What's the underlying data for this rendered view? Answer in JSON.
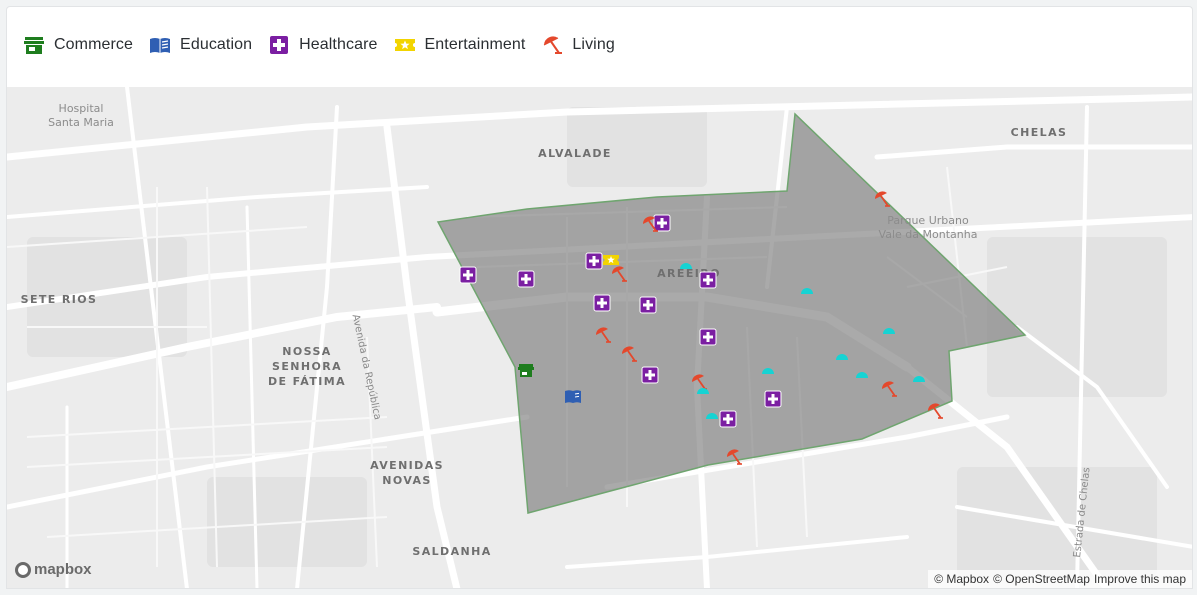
{
  "legend": [
    {
      "key": "commerce",
      "label": "Commerce",
      "icon": "store-icon",
      "color": "#1e7d1e"
    },
    {
      "key": "education",
      "label": "Education",
      "icon": "book-icon",
      "color": "#2f5fb3"
    },
    {
      "key": "healthcare",
      "label": "Healthcare",
      "icon": "plus-square-icon",
      "color": "#7b1fa2"
    },
    {
      "key": "entertainment",
      "label": "Entertainment",
      "icon": "star-ticket-icon",
      "color": "#f2d400"
    },
    {
      "key": "living",
      "label": "Living",
      "icon": "beach-umbrella-icon",
      "color": "#e4482c"
    }
  ],
  "map": {
    "area_fill": "#7d7d7d",
    "area_stroke": "#6fa56f",
    "extra_marker_color": "#16d3d3",
    "places": {
      "alvalade": "ALVALADE",
      "chelas": "CHELAS",
      "areeiro": "AREEIRO",
      "sete_rios": "SETE RIOS",
      "nossa_senhora": "NOSSA\nSENHORA\nDE FÁTIMA",
      "avenidas_novas": "AVENIDAS\nNOVAS",
      "saldanha": "SALDANHA"
    },
    "pois": {
      "hospital": "Hospital\nSanta Maria",
      "parque": "Parque Urbano\nVale da Montanha"
    },
    "streets": {
      "republica": "Avenida da República",
      "chelas": "Estrada de Chelas"
    },
    "logo": "mapbox",
    "attribution": [
      "© Mapbox",
      "© OpenStreetMap",
      "Improve this map"
    ]
  }
}
